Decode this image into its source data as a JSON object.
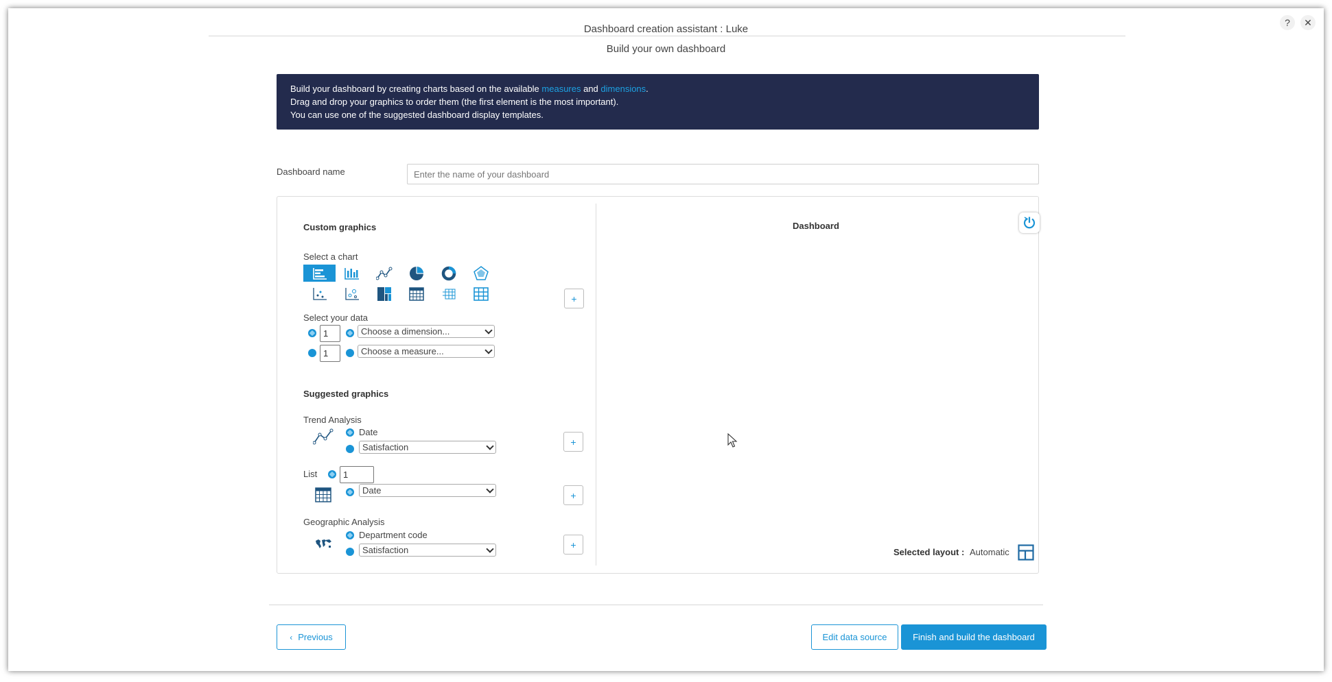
{
  "window": {
    "title": "Dashboard creation assistant : Luke",
    "help": "?",
    "close": "✕"
  },
  "subtitle": "Build your own dashboard",
  "info": {
    "line1_pre": "Build your dashboard by creating charts based on the available ",
    "measures": "measures",
    "and": " and ",
    "dimensions": "dimensions",
    "line1_post": ".",
    "line2": "Drag and drop your graphics to order them (the first element is the most important).",
    "line3": "You can use one of the suggested dashboard display templates."
  },
  "dashboard_name": {
    "label": "Dashboard name",
    "placeholder": "Enter the name of your dashboard"
  },
  "custom": {
    "title": "Custom graphics",
    "select_chart": "Select a chart",
    "select_data": "Select your data",
    "dimension_count": "1",
    "measure_count": "1",
    "dimension_select": "Choose a dimension...",
    "measure_select": "Choose a measure...",
    "add": "+"
  },
  "suggested": {
    "title": "Suggested graphics",
    "trend": {
      "label": "Trend Analysis",
      "dimension": "Date",
      "measure": "Satisfaction",
      "add": "+"
    },
    "list": {
      "label": "List",
      "count": "1",
      "dimension": "Date",
      "add": "+"
    },
    "geo": {
      "label": "Geographic Analysis",
      "dimension": "Department code",
      "measure": "Satisfaction",
      "add": "+"
    }
  },
  "preview": {
    "title": "Dashboard",
    "layout_label": "Selected layout :",
    "layout_value": "Automatic"
  },
  "footer": {
    "previous": "Previous",
    "edit": "Edit data source",
    "finish": "Finish and build the dashboard"
  },
  "colors": {
    "accent": "#1a94d6",
    "banner": "#232b4d"
  }
}
